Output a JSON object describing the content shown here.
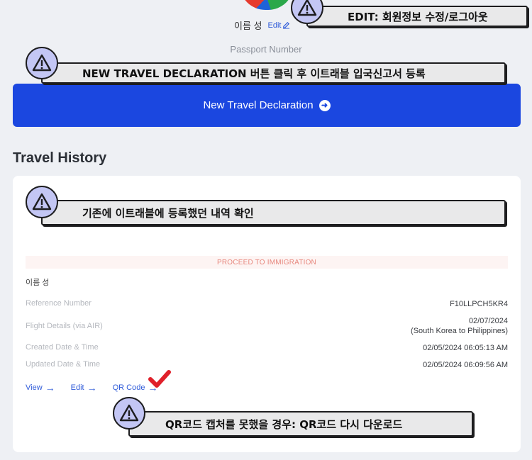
{
  "profile": {
    "name": "이름 성",
    "edit_label": "Edit"
  },
  "passport": {
    "label": "Passport Number"
  },
  "new_travel_button": {
    "label": "New Travel Declaration"
  },
  "travel_history": {
    "title": "Travel History",
    "status": "PROCEED TO IMMIGRATION",
    "traveler_name": "이름 성",
    "rows": [
      {
        "label": "Reference Number",
        "value": "F10LLPCH5KR4"
      },
      {
        "label": "Flight Details (via AIR)",
        "value": "02/07/2024",
        "value2": "(South Korea to Philippines)"
      },
      {
        "label": "Created Date & Time",
        "value": "02/05/2024 06:05:13 AM"
      },
      {
        "label": "Updated Date & Time",
        "value": "02/05/2024 06:09:56 AM"
      }
    ],
    "actions": {
      "view": "View",
      "edit": "Edit",
      "qr": "QR Code"
    }
  },
  "annotations": {
    "edit": "EDIT: 회원정보 수정/로그아웃",
    "new_travel": "NEW TRAVEL DECLARATION 버튼 클릭 후 이트래블 입국신고서 등록",
    "history": "기존에 이트래블에 등록했던 내역 확인",
    "qr": "QR코드 캡처를 못했을 경우: QR코드 다시 다운로드"
  },
  "colors": {
    "primary_blue": "#1b47e0",
    "link_blue": "#2f5bd9",
    "status_text": "#e7877d",
    "annotation_badge": "#c3c6f4",
    "check_red": "#e0202a"
  }
}
